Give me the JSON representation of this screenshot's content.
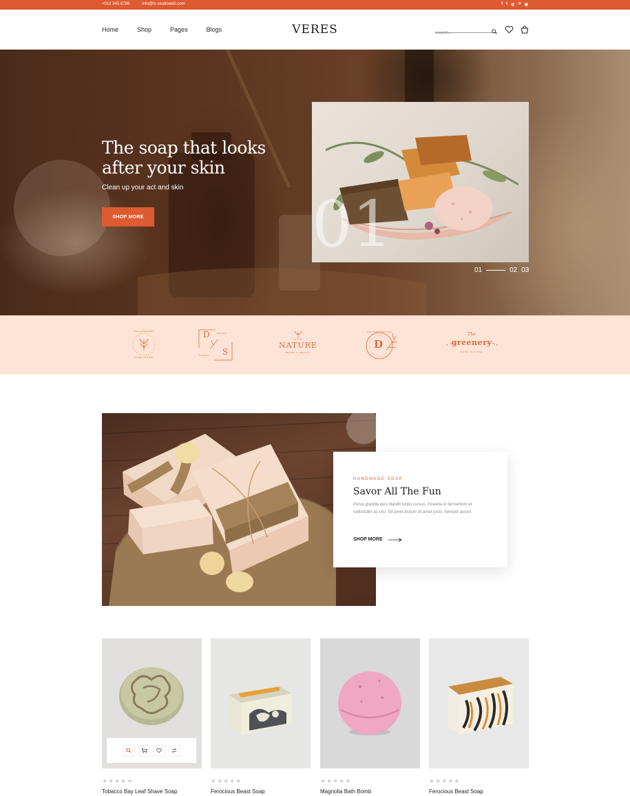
{
  "topbar": {
    "phone": "+012 345 6789",
    "email": "info@ts-studioweb.com",
    "social_icons": [
      "facebook-icon",
      "twitter-icon",
      "instagram-icon",
      "pinterest-icon",
      "dribbble-icon"
    ],
    "social_glyphs": [
      "f",
      "t",
      "◎",
      "℗",
      "◍"
    ]
  },
  "header": {
    "nav": [
      "Home",
      "Shop",
      "Pages",
      "Blogs"
    ],
    "logo": "VERES",
    "search_placeholder": "Search..."
  },
  "hero": {
    "title": "The soap that looks after your skin",
    "subtitle": "Clean up your act and skin",
    "button": "SHOP MORE",
    "slide_number": "01",
    "slides": {
      "current": "01",
      "next": "02",
      "last": "03"
    }
  },
  "brands": {
    "items": [
      {
        "top": "THE GREENERY",
        "bottom": "PURE NATURE"
      },
      {
        "letters": [
          "D",
          "S"
        ],
        "word1": "DESIGN",
        "word2": "STUDIO"
      },
      {
        "small_top": "STYLE",
        "main": "NATURE",
        "small_bottom": "BRAND & BEAUTY"
      },
      {
        "ring": "ART HANDCRAFTING",
        "letter": "D"
      },
      {
        "script": "The",
        "main": "greenery",
        "small": "PURE NATURE"
      }
    ]
  },
  "feature": {
    "eyebrow": "HANDMADE SOAP",
    "title": "Savor All The Fun",
    "text": "Purus gravida quis blandit turpis cursus. Gravida in fermentum et sollicitudin ac orci. Sit amet dictum sit amet justo. Semper auctor.",
    "link": "SHOP MORE"
  },
  "products": [
    {
      "name": "Tobacco Bay Leaf Shave Soap",
      "rating": 0
    },
    {
      "name": "Ferocious Beast Soap",
      "rating": 0
    },
    {
      "name": "Magnolia Bath Bomb",
      "rating": 0
    },
    {
      "name": "Ferocious Beast Soap",
      "rating": 0
    }
  ],
  "colors": {
    "accent": "#de5a30",
    "brand_band": "#fde4d6"
  }
}
